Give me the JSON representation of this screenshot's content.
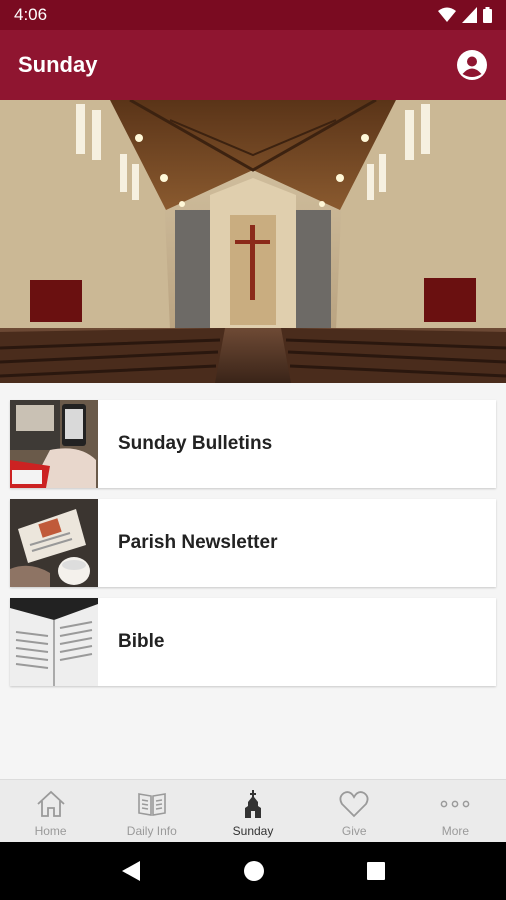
{
  "status_bar": {
    "time": "4:06"
  },
  "app_bar": {
    "title": "Sunday"
  },
  "menu_items": [
    {
      "label": "Sunday Bulletins"
    },
    {
      "label": "Parish Newsletter"
    },
    {
      "label": "Bible"
    }
  ],
  "bottom_nav": [
    {
      "label": "Home",
      "icon": "home-icon"
    },
    {
      "label": "Daily Info",
      "icon": "book-icon"
    },
    {
      "label": "Sunday",
      "icon": "church-icon",
      "active": true
    },
    {
      "label": "Give",
      "icon": "heart-icon"
    },
    {
      "label": "More",
      "icon": "more-icon"
    }
  ],
  "colors": {
    "status_bar": "#7a0b21",
    "app_bar": "#8f1530",
    "active_nav": "#333333",
    "inactive_nav": "#9a9a9a"
  }
}
